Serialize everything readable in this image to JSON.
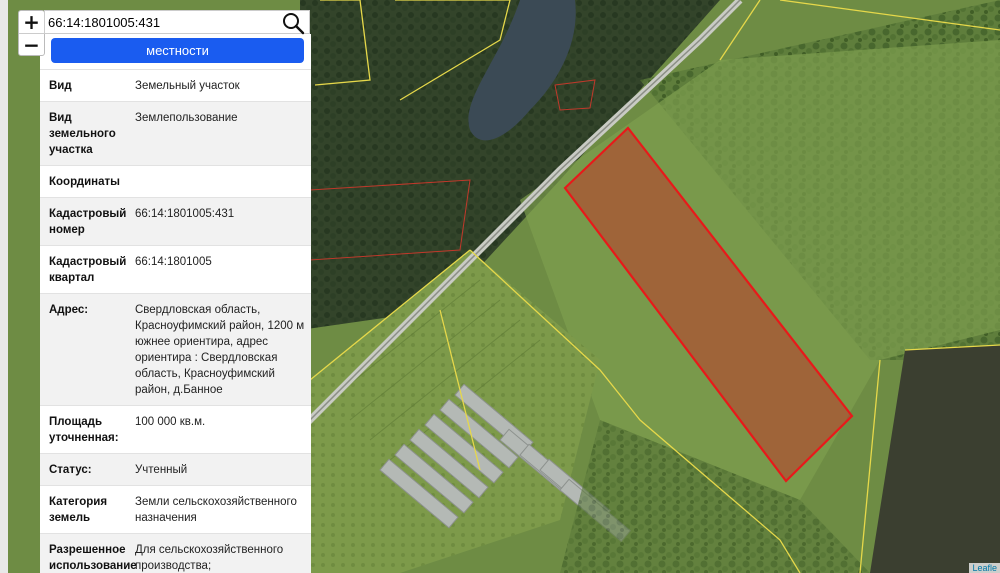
{
  "search": {
    "value": "66:14:1801005:431"
  },
  "zoom": {
    "in": "+",
    "out": "−"
  },
  "panel": {
    "button": "местности",
    "rows": [
      {
        "key": "Вид",
        "value": "Земельный участок"
      },
      {
        "key": "Вид земельного участка",
        "value": "Землепользование"
      },
      {
        "key": "Координаты",
        "value": ""
      },
      {
        "key": "Кадастровый номер",
        "value": "66:14:1801005:431"
      },
      {
        "key": "Кадастровый квартал",
        "value": "66:14:1801005"
      },
      {
        "key": "Адрес:",
        "value": "Свердловская область, Красноуфимский район, 1200 м южнее ориентира, адрес ориентира : Свердловская область, Красноуфимский район, д.Банное"
      },
      {
        "key": "Площадь уточненная:",
        "value": "100 000 кв.м."
      },
      {
        "key": "Статус:",
        "value": "Учтенный"
      },
      {
        "key": "Категория земель",
        "value": "Земли сельскохозяйственного назначения"
      },
      {
        "key": "Разрешенное использование",
        "value": "Для сельскохозяйственного производства;"
      }
    ]
  },
  "attribution": "Leafle",
  "colors": {
    "parcel_outline": "#e8191a",
    "parcel_fill": "#c0392b",
    "boundary": "#e6d84a",
    "button": "#1a5cf0"
  }
}
